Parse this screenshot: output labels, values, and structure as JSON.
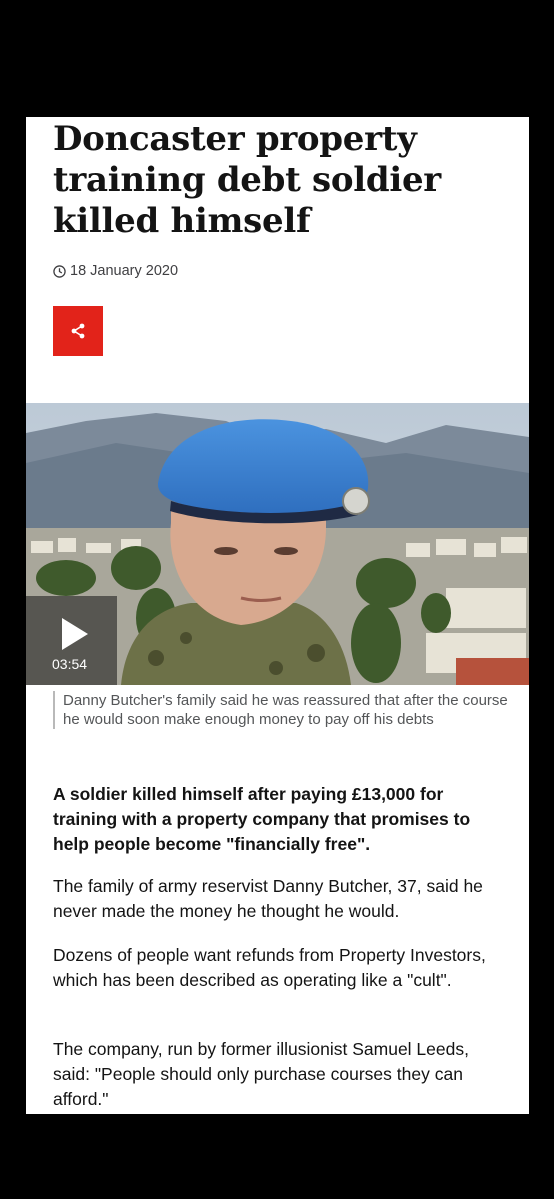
{
  "article": {
    "headline": "Doncaster property training debt soldier killed himself",
    "date": "18 January 2020",
    "media": {
      "duration": "03:54",
      "caption": "Danny Butcher's family said he was reassured that after the course he would soon make enough money to pay off his debts"
    },
    "lead": "A soldier killed himself after paying £13,000 for training with a property company that promises to help people become \"financially free\".",
    "paragraphs": [
      "The family of army reservist Danny Butcher, 37, said he never made the money he thought he would.",
      "Dozens of people want refunds from Property Investors, which has been described as operating like a \"cult\".",
      "The company, run by former illusionist Samuel Leeds, said: \"People should only purchase courses they can afford.\""
    ]
  },
  "icons": {
    "clock": "clock-icon",
    "share": "share-icon",
    "play": "play-icon"
  },
  "colors": {
    "share_button": "#e2231a",
    "beret": "#3a7fd0",
    "text": "#141414"
  }
}
